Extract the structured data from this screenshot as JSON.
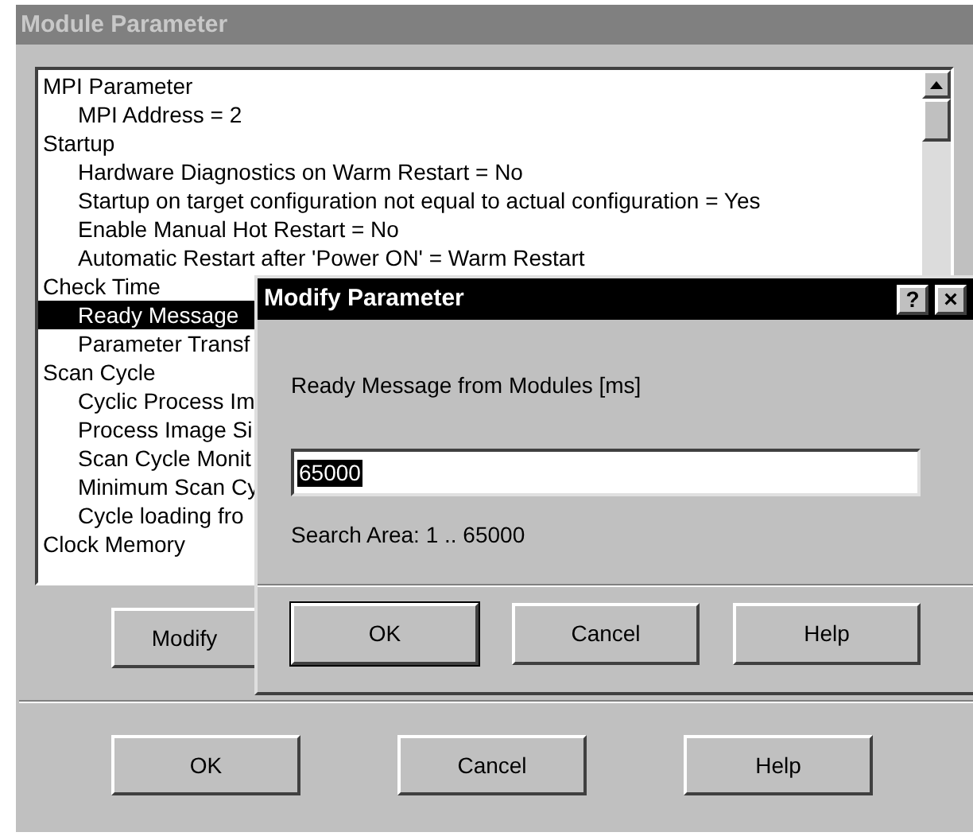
{
  "window": {
    "title": "Module Parameter"
  },
  "tree": [
    {
      "label": "MPI Parameter",
      "selected": false,
      "children": [
        {
          "label": "MPI Address = 2",
          "selected": false
        }
      ]
    },
    {
      "label": "Startup",
      "selected": false,
      "children": [
        {
          "label": "Hardware Diagnostics on Warm Restart = No",
          "selected": false
        },
        {
          "label": "Startup on target configuration not equal to actual configuration = Yes",
          "selected": false
        },
        {
          "label": "Enable Manual Hot Restart = No",
          "selected": false
        },
        {
          "label": "Automatic Restart after 'Power ON' = Warm Restart",
          "selected": false
        }
      ]
    },
    {
      "label": "Check Time",
      "selected": false,
      "children": [
        {
          "label": "Ready Message",
          "selected": true
        },
        {
          "label": "Parameter Transf",
          "selected": false
        }
      ]
    },
    {
      "label": "Scan Cycle",
      "selected": false,
      "children": [
        {
          "label": "Cyclic Process Im",
          "selected": false
        },
        {
          "label": "Process Image Si",
          "selected": false
        },
        {
          "label": "Scan Cycle Monit",
          "selected": false
        },
        {
          "label": "Minimum Scan Cy",
          "selected": false
        },
        {
          "label": "Cycle loading fro",
          "selected": false
        }
      ]
    },
    {
      "label": "Clock Memory",
      "selected": false
    }
  ],
  "modify_button": "Modify",
  "buttons": [
    "OK",
    "Cancel",
    "Help"
  ],
  "dialog": {
    "title": "Modify Parameter",
    "help_button": "?",
    "close_button": "×",
    "prompt": "Ready Message from Modules [ms]",
    "value": "65000",
    "range": "Search Area:  1 .. 65000",
    "buttons": [
      "OK",
      "Cancel",
      "Help"
    ]
  }
}
